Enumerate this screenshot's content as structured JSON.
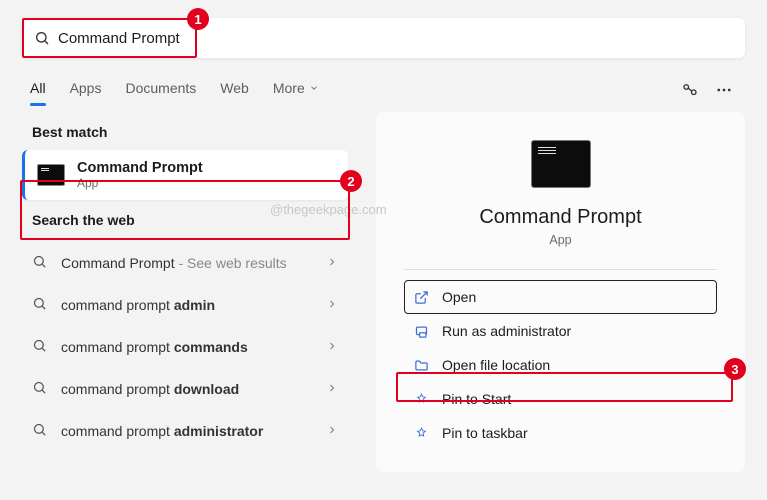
{
  "search": {
    "value": "Command Prompt"
  },
  "tabs": {
    "all": "All",
    "apps": "Apps",
    "documents": "Documents",
    "web": "Web",
    "more": "More"
  },
  "left": {
    "best_match_label": "Best match",
    "best_match": {
      "title": "Command Prompt",
      "subtitle": "App"
    },
    "search_web_label": "Search the web",
    "web_items": [
      {
        "prefix": "Command Prompt",
        "bold": "",
        "suffix": " - See web results"
      },
      {
        "prefix": "command prompt ",
        "bold": "admin",
        "suffix": ""
      },
      {
        "prefix": "command prompt ",
        "bold": "commands",
        "suffix": ""
      },
      {
        "prefix": "command prompt ",
        "bold": "download",
        "suffix": ""
      },
      {
        "prefix": "command prompt ",
        "bold": "administrator",
        "suffix": ""
      }
    ]
  },
  "detail": {
    "title": "Command Prompt",
    "subtitle": "App",
    "actions": {
      "open": "Open",
      "run_admin": "Run as administrator",
      "open_location": "Open file location",
      "pin_start": "Pin to Start",
      "pin_taskbar": "Pin to taskbar"
    }
  },
  "watermark": "@thegeekpage.com",
  "annotations": {
    "a1": "1",
    "a2": "2",
    "a3": "3"
  }
}
